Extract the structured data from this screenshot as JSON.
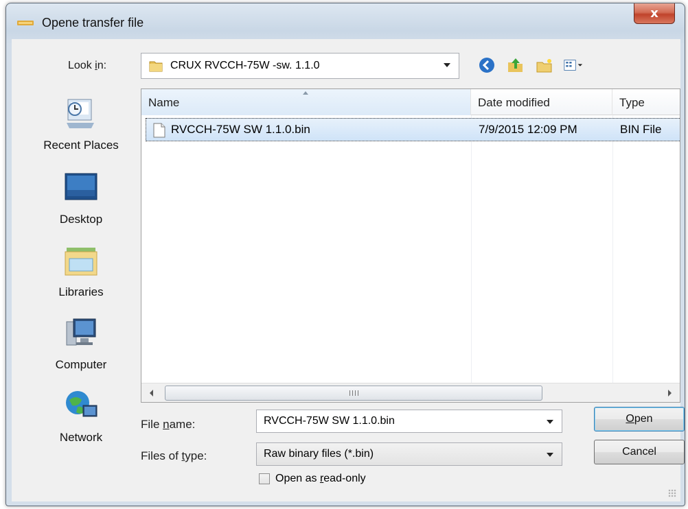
{
  "window": {
    "title": "Opene transfer file",
    "close_label": "x"
  },
  "lookin": {
    "label_pre": "Look ",
    "label_u": "i",
    "label_post": "n:",
    "value": "CRUX RVCCH-75W -sw. 1.1.0"
  },
  "toolbar": {
    "icons": [
      "back-icon",
      "up-folder-icon",
      "new-folder-icon",
      "view-menu-icon"
    ]
  },
  "places": [
    {
      "label": "Recent Places",
      "icon": "recent-places-icon"
    },
    {
      "label": "Desktop",
      "icon": "desktop-icon"
    },
    {
      "label": "Libraries",
      "icon": "libraries-icon"
    },
    {
      "label": "Computer",
      "icon": "computer-icon"
    },
    {
      "label": "Network",
      "icon": "network-icon"
    }
  ],
  "filelist": {
    "columns": [
      "Name",
      "Date modified",
      "Type"
    ],
    "rows": [
      {
        "name": "RVCCH-75W SW 1.1.0.bin",
        "date": "7/9/2015 12:09 PM",
        "type": "BIN File"
      }
    ],
    "scroll_grip": "III"
  },
  "fields": {
    "filename_label_pre": "File ",
    "filename_label_u": "n",
    "filename_label_post": "ame:",
    "filename_value": "RVCCH-75W SW 1.1.0.bin",
    "filetype_label_pre": "Files of ",
    "filetype_label_u": "t",
    "filetype_label_post": "ype:",
    "filetype_value": "Raw binary files (*.bin)",
    "readonly_pre": "Open as ",
    "readonly_u": "r",
    "readonly_post": "ead-only"
  },
  "buttons": {
    "open_u": "O",
    "open_rest": "pen",
    "cancel": "Cancel"
  }
}
